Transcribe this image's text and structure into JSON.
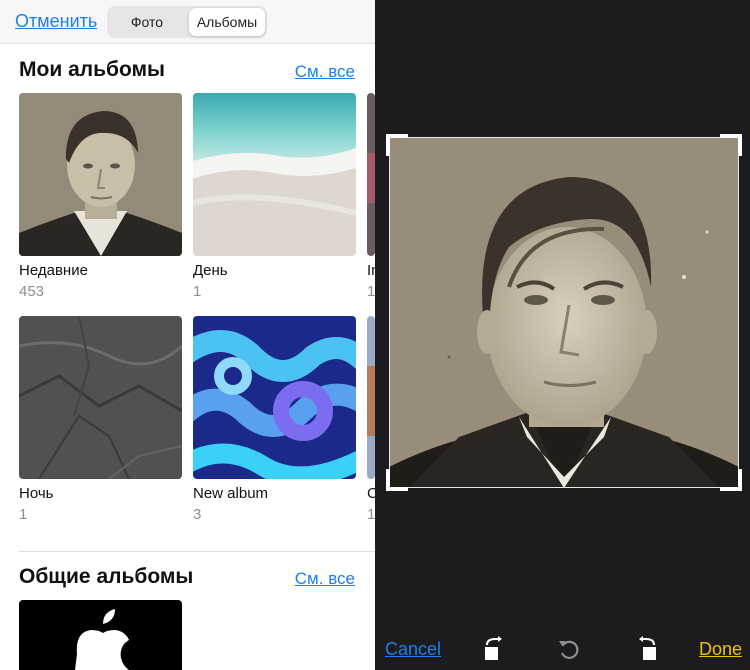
{
  "left_panel": {
    "cancel_label": "Отменить",
    "tabs": [
      {
        "label": "Фото",
        "selected": false
      },
      {
        "label": "Альбомы",
        "selected": true
      }
    ],
    "my_albums": {
      "title": "Мои альбомы",
      "see_all": "См. все",
      "albums": [
        {
          "name": "Недавние",
          "count": "453",
          "thumb": "portrait"
        },
        {
          "name": "День",
          "count": "1",
          "thumb": "beach"
        },
        {
          "name": "In",
          "count": "1",
          "thumb": "partial"
        },
        {
          "name": "Ночь",
          "count": "1",
          "thumb": "stone"
        },
        {
          "name": "New album",
          "count": "3",
          "thumb": "swirls"
        },
        {
          "name": "C",
          "count": "1",
          "thumb": "partial"
        }
      ]
    },
    "shared_albums": {
      "title": "Общие альбомы",
      "see_all": "См. все",
      "thumb": "apple-logo"
    }
  },
  "right_panel": {
    "cancel_label": "Cancel",
    "done_label": "Done",
    "tools": [
      "rotate-left-icon",
      "reset-rotation-icon",
      "rotate-right-icon"
    ],
    "colors": {
      "cancel": "#1d7fe8",
      "done": "#f2c200",
      "background": "#1c1c1e"
    }
  }
}
